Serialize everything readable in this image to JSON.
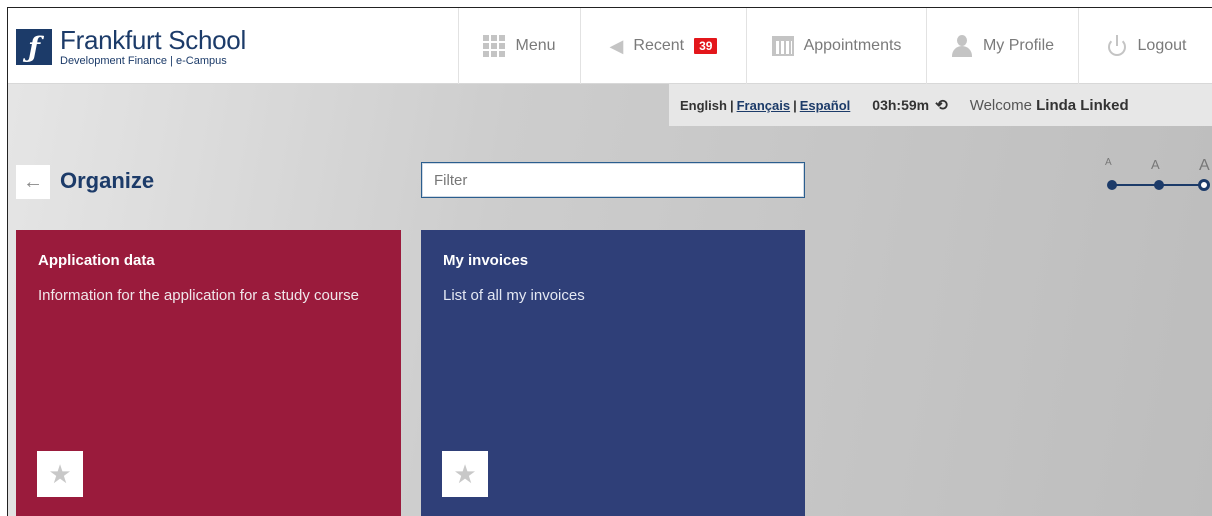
{
  "brand": {
    "title": "Frankfurt School",
    "subtitle": "Development Finance | e-Campus",
    "logo_glyph": "ƒ",
    "color": "#1c3b69"
  },
  "nav": {
    "menu": "Menu",
    "recent": "Recent",
    "recent_count": "39",
    "appointments": "Appointments",
    "profile": "My Profile",
    "logout": "Logout"
  },
  "infobar": {
    "lang_english": "English",
    "lang_french": "Français",
    "lang_spanish": "Español",
    "sep": "|",
    "timer": "03h:59m",
    "welcome_prefix": "Welcome",
    "user_name": "Linda Linked"
  },
  "page": {
    "title": "Organize",
    "back_glyph": "←"
  },
  "filter": {
    "placeholder": "Filter",
    "value": ""
  },
  "font_sizes": [
    "A",
    "A",
    "A"
  ],
  "tiles": [
    {
      "title": "Application data",
      "description": "Information for the application for a study course",
      "color": "#9a1b3c"
    },
    {
      "title": "My invoices",
      "description": "List of all my invoices",
      "color": "#2f3f78"
    }
  ],
  "icons": {
    "star": "★",
    "history": "⟲",
    "megaphone": "◀"
  }
}
